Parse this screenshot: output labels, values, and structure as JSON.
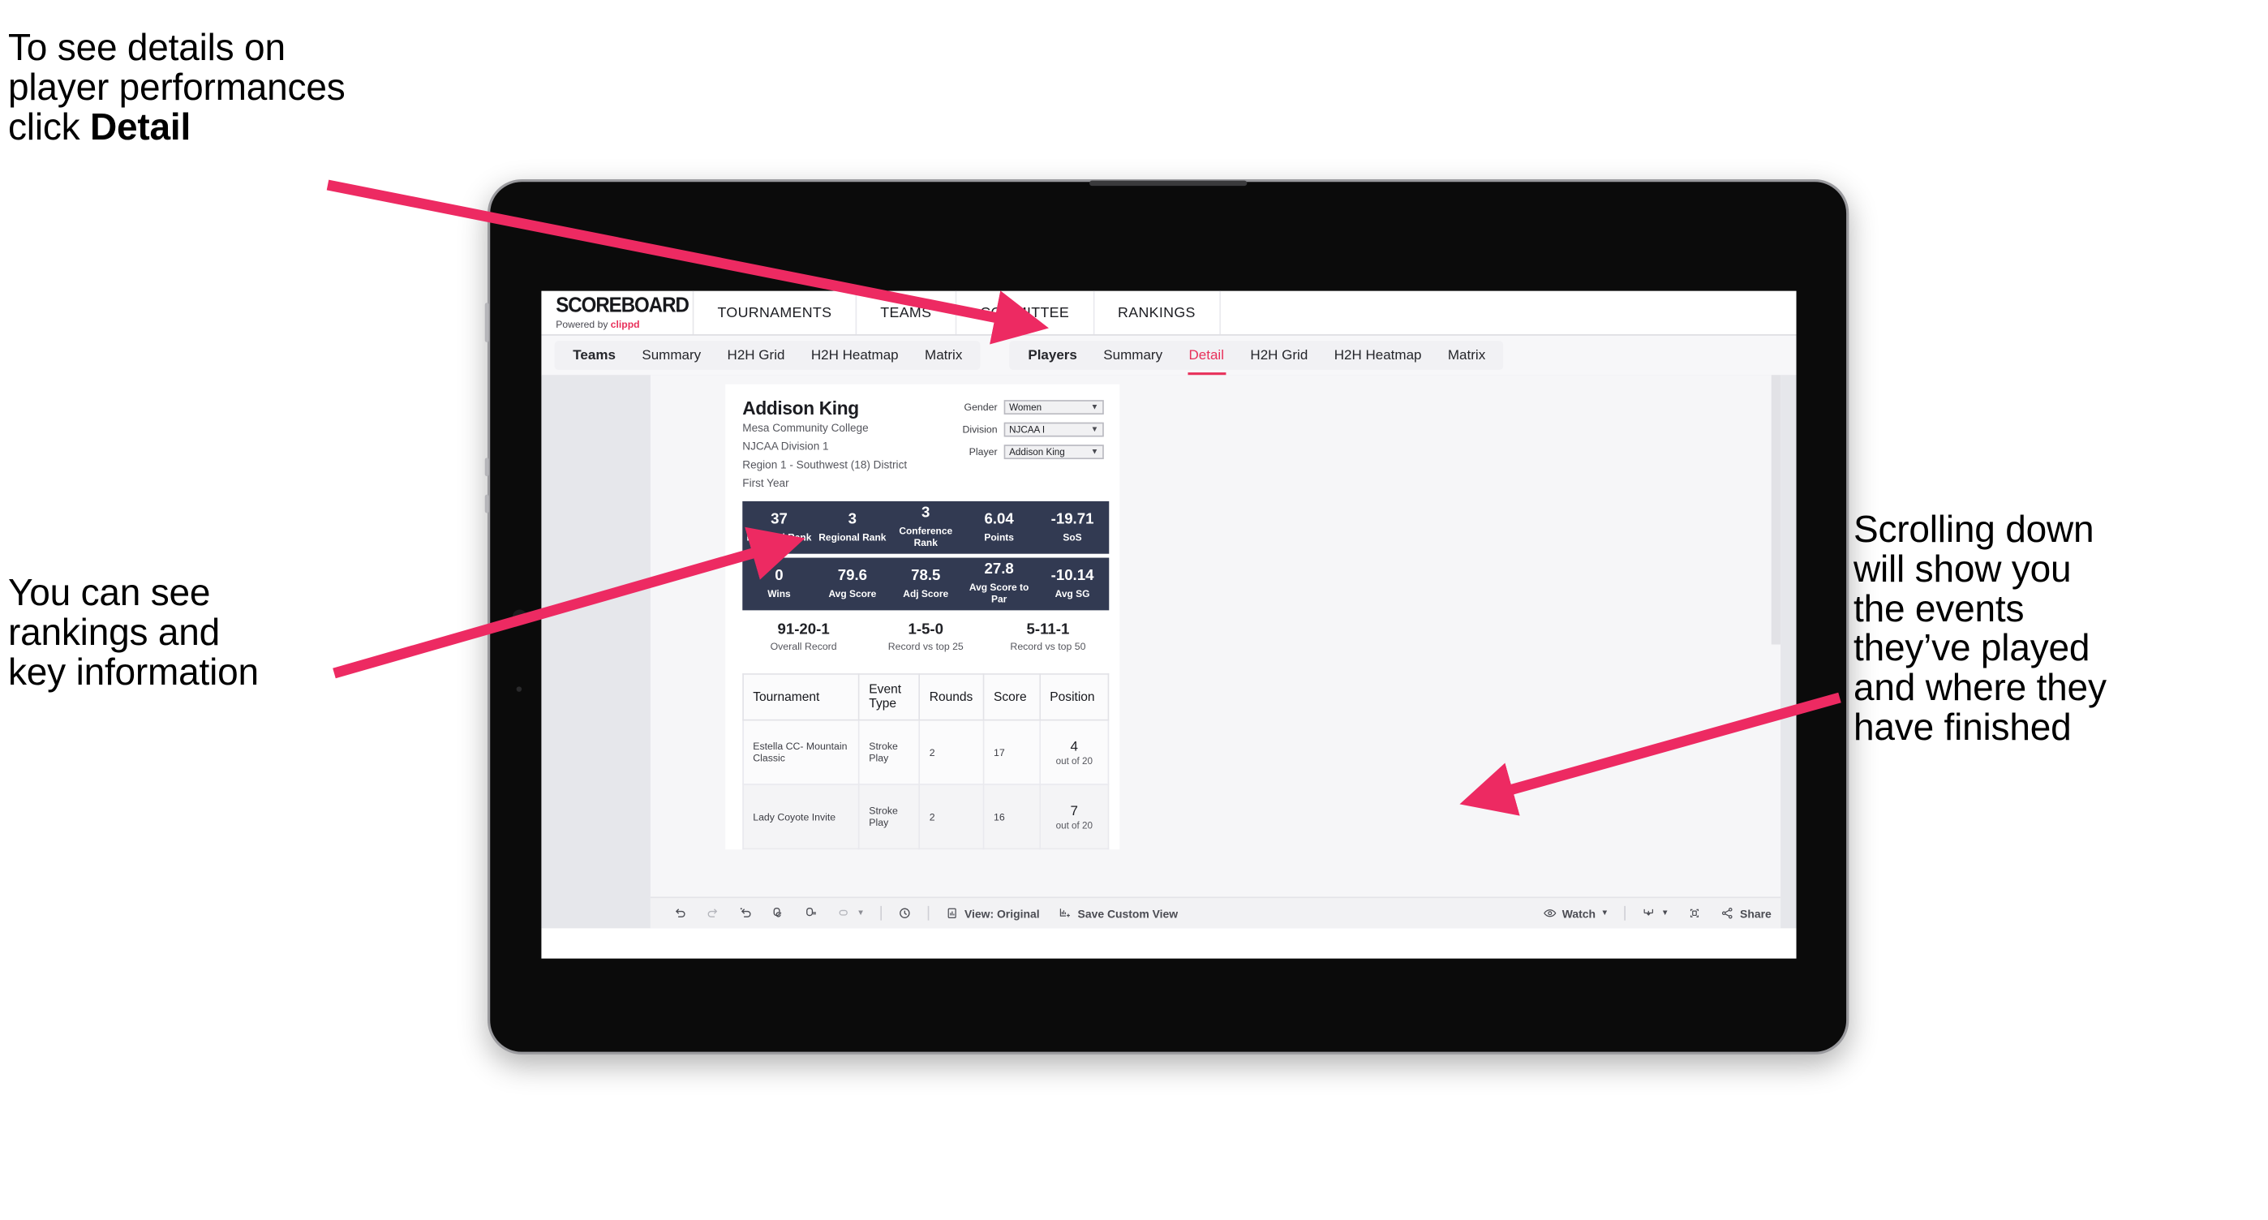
{
  "annotations": {
    "top_left": {
      "line1": "To see details on",
      "line2": "player performances",
      "line3_prefix": "click ",
      "line3_bold": "Detail"
    },
    "mid_left": {
      "line1": "You can see",
      "line2": "rankings and",
      "line3": "key information"
    },
    "right": {
      "line1": "Scrolling down",
      "line2": "will show you",
      "line3": "the events",
      "line4": "they’ve played",
      "line5": "and where they",
      "line6": "have finished"
    },
    "arrow_color": "#ED2A62"
  },
  "app": {
    "brand": {
      "word": "SCOREBOARD",
      "powered_prefix": "Powered by ",
      "powered_name": "clippd"
    },
    "top_nav": [
      {
        "label": "TOURNAMENTS"
      },
      {
        "label": "TEAMS"
      },
      {
        "label": "COMMITTEE"
      },
      {
        "label": "RANKINGS"
      }
    ],
    "tab_groups": [
      {
        "group_label": "Teams",
        "tabs": [
          {
            "label": "Summary",
            "active": false
          },
          {
            "label": "H2H Grid",
            "active": false
          },
          {
            "label": "H2H Heatmap",
            "active": false
          },
          {
            "label": "Matrix",
            "active": false
          }
        ]
      },
      {
        "group_label": "Players",
        "tabs": [
          {
            "label": "Summary",
            "active": false
          },
          {
            "label": "Detail",
            "active": true
          },
          {
            "label": "H2H Grid",
            "active": false
          },
          {
            "label": "H2H Heatmap",
            "active": false
          },
          {
            "label": "Matrix",
            "active": false
          }
        ]
      }
    ]
  },
  "player": {
    "name": "Addison King",
    "school": "Mesa Community College",
    "division": "NJCAA Division 1",
    "region": "Region 1 - Southwest (18) District",
    "year": "First Year"
  },
  "filters": [
    {
      "label": "Gender",
      "value": "Women"
    },
    {
      "label": "Division",
      "value": "NJCAA I"
    },
    {
      "label": "Player",
      "value": "Addison King"
    }
  ],
  "stats_row_1": [
    {
      "value": "37",
      "label": "National Rank"
    },
    {
      "value": "3",
      "label": "Regional Rank"
    },
    {
      "value": "3",
      "label": "Conference Rank"
    },
    {
      "value": "6.04",
      "label": "Points"
    },
    {
      "value": "-19.71",
      "label": "SoS"
    }
  ],
  "stats_row_2": [
    {
      "value": "0",
      "label": "Wins"
    },
    {
      "value": "79.6",
      "label": "Avg Score"
    },
    {
      "value": "78.5",
      "label": "Adj Score"
    },
    {
      "value": "27.8",
      "label": "Avg Score to Par"
    },
    {
      "value": "-10.14",
      "label": "Avg SG"
    }
  ],
  "records": [
    {
      "value": "91-20-1",
      "label": "Overall Record"
    },
    {
      "value": "1-5-0",
      "label": "Record vs top 25"
    },
    {
      "value": "5-11-1",
      "label": "Record vs top 50"
    }
  ],
  "events_table": {
    "columns": [
      "Tournament",
      "Event Type",
      "Rounds",
      "Score",
      "Position"
    ],
    "rows": [
      {
        "tournament": "Estella CC- Mountain Classic",
        "event_type": "Stroke Play",
        "rounds": "2",
        "score": "17",
        "position": "4",
        "out_of": "out of 20"
      },
      {
        "tournament": "Lady Coyote Invite",
        "event_type": "Stroke Play",
        "rounds": "2",
        "score": "16",
        "position": "7",
        "out_of": "out of 20"
      }
    ]
  },
  "toolbar": {
    "view_label": "View: Original",
    "save_label": "Save Custom View",
    "watch_label": "Watch",
    "share_label": "Share"
  },
  "colors": {
    "accent_pink": "#E8305A",
    "stat_panel": "#323A52",
    "page_bg": "#E6E7EB"
  }
}
